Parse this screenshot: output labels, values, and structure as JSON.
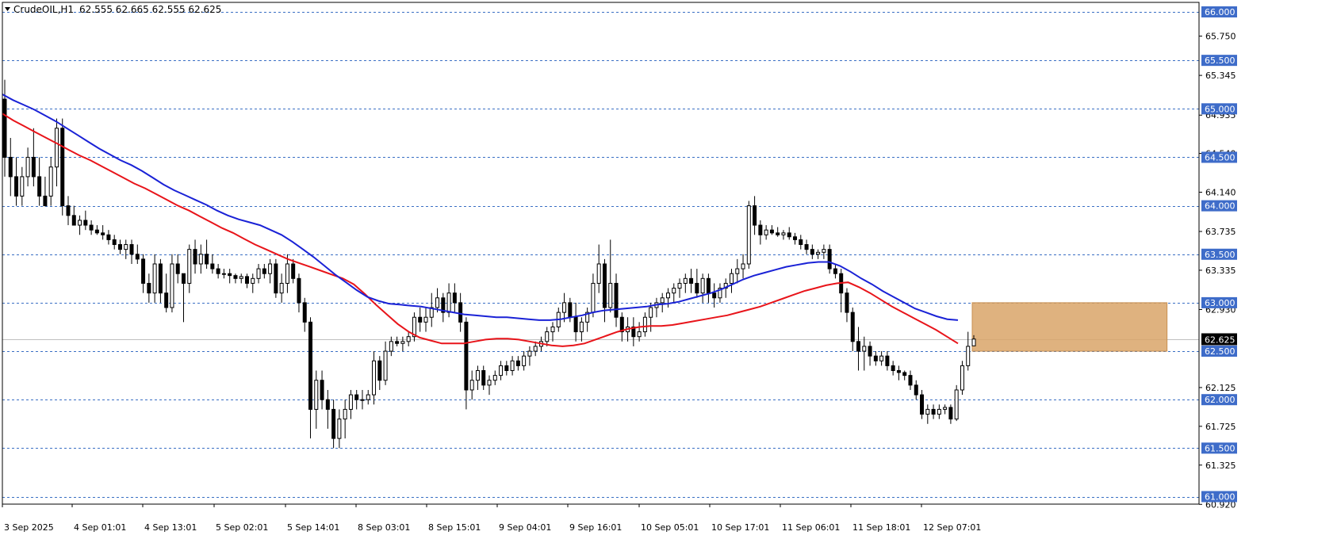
{
  "header": {
    "symbol": "CrudeOIL,H1",
    "ohlc": "62.555 62.665 62.555 62.625"
  },
  "colors": {
    "background": "#ffffff",
    "grid": "#3a6fc4",
    "axis": "#000000",
    "bull_candle": "#ffffff",
    "bear_candle": "#000000",
    "ma_fast": "#e8141a",
    "ma_slow": "#1a22d6",
    "zone": "#d9a468",
    "price_badge": "#000000",
    "level_badge": "#3e6cc9"
  },
  "chart_data": {
    "type": "candlestick",
    "ylim": [
      60.82,
      66.1
    ],
    "y_tick_labels": [
      "65.750",
      "65.345",
      "64.935",
      "64.540",
      "64.140",
      "63.735",
      "63.335",
      "62.930",
      "62.125",
      "61.725",
      "61.325",
      "60.920"
    ],
    "level_labels": [
      "66.000",
      "65.500",
      "65.000",
      "64.500",
      "64.000",
      "63.500",
      "63.000",
      "62.500",
      "62.000",
      "61.500",
      "61.000"
    ],
    "levels": [
      66.0,
      65.5,
      65.0,
      64.5,
      64.0,
      63.5,
      63.0,
      62.5,
      62.0,
      61.5,
      61.0
    ],
    "current_price": 62.625,
    "current_price_label": "62.625",
    "x_tick_labels": [
      "3 Sep 2025",
      "4 Sep 01:01",
      "4 Sep 13:01",
      "5 Sep 02:01",
      "5 Sep 14:01",
      "8 Sep 03:01",
      "8 Sep 15:01",
      "9 Sep 04:01",
      "9 Sep 16:01",
      "10 Sep 05:01",
      "10 Sep 17:01",
      "11 Sep 06:01",
      "11 Sep 18:01",
      "12 Sep 07:01"
    ],
    "candles": [
      [
        65.1,
        65.3,
        64.3,
        64.5
      ],
      [
        64.5,
        64.7,
        64.1,
        64.3
      ],
      [
        64.3,
        64.5,
        64.0,
        64.1
      ],
      [
        64.1,
        64.4,
        64.0,
        64.3
      ],
      [
        64.3,
        64.6,
        64.2,
        64.5
      ],
      [
        64.5,
        64.8,
        64.2,
        64.3
      ],
      [
        64.3,
        64.5,
        64.0,
        64.1
      ],
      [
        64.1,
        64.3,
        64.0,
        64.0
      ],
      [
        64.1,
        64.5,
        64.0,
        64.4
      ],
      [
        64.4,
        64.9,
        64.2,
        64.8
      ],
      [
        64.8,
        64.9,
        63.9,
        64.0
      ],
      [
        64.0,
        64.1,
        63.8,
        63.9
      ],
      [
        63.9,
        64.0,
        63.8,
        63.8
      ],
      [
        63.8,
        63.9,
        63.7,
        63.85
      ],
      [
        63.85,
        63.95,
        63.75,
        63.8
      ],
      [
        63.8,
        63.85,
        63.7,
        63.75
      ],
      [
        63.75,
        63.8,
        63.7,
        63.72
      ],
      [
        63.72,
        63.8,
        63.65,
        63.7
      ],
      [
        63.7,
        63.75,
        63.6,
        63.65
      ],
      [
        63.65,
        63.7,
        63.55,
        63.6
      ],
      [
        63.6,
        63.65,
        63.5,
        63.55
      ],
      [
        63.55,
        63.65,
        63.45,
        63.6
      ],
      [
        63.6,
        63.65,
        63.4,
        63.5
      ],
      [
        63.5,
        63.6,
        63.4,
        63.45
      ],
      [
        63.45,
        63.5,
        63.1,
        63.2
      ],
      [
        63.2,
        63.3,
        63.0,
        63.1
      ],
      [
        63.1,
        63.5,
        63.0,
        63.4
      ],
      [
        63.4,
        63.45,
        63.0,
        63.1
      ],
      [
        63.1,
        63.3,
        62.9,
        62.95
      ],
      [
        62.95,
        63.5,
        62.9,
        63.4
      ],
      [
        63.4,
        63.5,
        63.2,
        63.3
      ],
      [
        63.3,
        63.3,
        62.8,
        63.2
      ],
      [
        63.2,
        63.6,
        63.1,
        63.55
      ],
      [
        63.55,
        63.65,
        63.3,
        63.4
      ],
      [
        63.4,
        63.6,
        63.3,
        63.5
      ],
      [
        63.5,
        63.65,
        63.35,
        63.4
      ],
      [
        63.4,
        63.5,
        63.3,
        63.35
      ],
      [
        63.35,
        63.4,
        63.25,
        63.3
      ],
      [
        63.3,
        63.35,
        63.25,
        63.3
      ],
      [
        63.3,
        63.35,
        63.2,
        63.28
      ],
      [
        63.28,
        63.3,
        63.2,
        63.25
      ],
      [
        63.25,
        63.3,
        63.2,
        63.27
      ],
      [
        63.27,
        63.3,
        63.15,
        63.2
      ],
      [
        63.2,
        63.3,
        63.1,
        63.25
      ],
      [
        63.25,
        63.4,
        63.2,
        63.35
      ],
      [
        63.35,
        63.4,
        63.25,
        63.3
      ],
      [
        63.3,
        63.45,
        63.2,
        63.4
      ],
      [
        63.4,
        63.45,
        63.05,
        63.1
      ],
      [
        63.1,
        63.3,
        63.0,
        63.2
      ],
      [
        63.2,
        63.5,
        63.1,
        63.4
      ],
      [
        63.4,
        63.45,
        63.2,
        63.25
      ],
      [
        63.25,
        63.3,
        62.9,
        63.0
      ],
      [
        63.0,
        63.05,
        62.7,
        62.8
      ],
      [
        62.8,
        62.85,
        61.6,
        61.9
      ],
      [
        61.9,
        62.3,
        61.7,
        62.2
      ],
      [
        62.2,
        62.3,
        61.9,
        62.0
      ],
      [
        62.0,
        62.1,
        61.7,
        61.9
      ],
      [
        61.9,
        62.0,
        61.5,
        61.6
      ],
      [
        61.6,
        61.9,
        61.5,
        61.8
      ],
      [
        61.8,
        62.0,
        61.6,
        61.9
      ],
      [
        61.9,
        62.1,
        61.8,
        62.05
      ],
      [
        62.05,
        62.1,
        61.9,
        62.0
      ],
      [
        62.0,
        62.1,
        61.9,
        62.0
      ],
      [
        62.0,
        62.1,
        61.95,
        62.05
      ],
      [
        62.05,
        62.5,
        61.95,
        62.4
      ],
      [
        62.4,
        62.45,
        62.1,
        62.2
      ],
      [
        62.2,
        62.6,
        62.15,
        62.5
      ],
      [
        62.5,
        62.65,
        62.45,
        62.6
      ],
      [
        62.6,
        62.65,
        62.55,
        62.58
      ],
      [
        62.58,
        62.65,
        62.5,
        62.6
      ],
      [
        62.6,
        62.7,
        62.55,
        62.65
      ],
      [
        62.65,
        62.9,
        62.6,
        62.85
      ],
      [
        62.85,
        62.95,
        62.7,
        62.8
      ],
      [
        62.8,
        62.95,
        62.7,
        62.85
      ],
      [
        62.85,
        63.1,
        62.75,
        62.95
      ],
      [
        62.95,
        63.15,
        62.9,
        63.05
      ],
      [
        63.05,
        63.1,
        62.8,
        62.9
      ],
      [
        62.9,
        63.2,
        62.85,
        63.1
      ],
      [
        63.1,
        63.2,
        62.9,
        63.0
      ],
      [
        63.0,
        63.1,
        62.7,
        62.8
      ],
      [
        62.8,
        62.85,
        61.9,
        62.1
      ],
      [
        62.1,
        62.3,
        62.0,
        62.2
      ],
      [
        62.2,
        62.35,
        62.1,
        62.3
      ],
      [
        62.3,
        62.35,
        62.1,
        62.15
      ],
      [
        62.15,
        62.25,
        62.05,
        62.2
      ],
      [
        62.2,
        62.3,
        62.15,
        62.25
      ],
      [
        62.25,
        62.4,
        62.2,
        62.35
      ],
      [
        62.35,
        62.4,
        62.25,
        62.3
      ],
      [
        62.3,
        62.45,
        62.25,
        62.4
      ],
      [
        62.4,
        62.45,
        62.3,
        62.35
      ],
      [
        62.35,
        62.5,
        62.3,
        62.45
      ],
      [
        62.45,
        62.55,
        62.35,
        62.5
      ],
      [
        62.5,
        62.6,
        62.45,
        62.55
      ],
      [
        62.55,
        62.65,
        62.5,
        62.6
      ],
      [
        62.6,
        62.75,
        62.55,
        62.7
      ],
      [
        62.7,
        62.8,
        62.6,
        62.75
      ],
      [
        62.75,
        62.95,
        62.7,
        62.9
      ],
      [
        62.9,
        63.1,
        62.8,
        63.0
      ],
      [
        63.0,
        63.05,
        62.8,
        62.85
      ],
      [
        62.85,
        63.0,
        62.6,
        62.7
      ],
      [
        62.7,
        62.85,
        62.6,
        62.8
      ],
      [
        62.8,
        62.95,
        62.7,
        62.9
      ],
      [
        62.9,
        63.3,
        62.85,
        63.2
      ],
      [
        63.2,
        63.6,
        63.1,
        63.4
      ],
      [
        63.4,
        63.45,
        62.8,
        62.95
      ],
      [
        62.95,
        63.65,
        62.9,
        63.2
      ],
      [
        63.2,
        63.3,
        62.75,
        62.85
      ],
      [
        62.85,
        62.9,
        62.6,
        62.7
      ],
      [
        62.7,
        62.85,
        62.6,
        62.75
      ],
      [
        62.75,
        62.85,
        62.55,
        62.65
      ],
      [
        62.65,
        62.8,
        62.6,
        62.7
      ],
      [
        62.7,
        62.9,
        62.65,
        62.85
      ],
      [
        62.85,
        63.0,
        62.7,
        62.95
      ],
      [
        62.95,
        63.05,
        62.85,
        63.0
      ],
      [
        63.0,
        63.1,
        62.9,
        63.05
      ],
      [
        63.05,
        63.15,
        62.95,
        63.1
      ],
      [
        63.1,
        63.2,
        63.0,
        63.15
      ],
      [
        63.15,
        63.25,
        63.05,
        63.2
      ],
      [
        63.2,
        63.3,
        63.1,
        63.25
      ],
      [
        63.25,
        63.35,
        63.1,
        63.2
      ],
      [
        63.2,
        63.35,
        63.05,
        63.1
      ],
      [
        63.1,
        63.3,
        63.0,
        63.25
      ],
      [
        63.25,
        63.3,
        63.0,
        63.1
      ],
      [
        63.1,
        63.2,
        62.95,
        63.05
      ],
      [
        63.05,
        63.2,
        63.0,
        63.15
      ],
      [
        63.15,
        63.25,
        63.05,
        63.2
      ],
      [
        63.2,
        63.35,
        63.1,
        63.3
      ],
      [
        63.3,
        63.45,
        63.2,
        63.35
      ],
      [
        63.35,
        63.5,
        63.25,
        63.4
      ],
      [
        63.4,
        64.05,
        63.35,
        64.0
      ],
      [
        64.0,
        64.1,
        63.7,
        63.8
      ],
      [
        63.8,
        63.85,
        63.6,
        63.7
      ],
      [
        63.7,
        63.8,
        63.65,
        63.75
      ],
      [
        63.75,
        63.8,
        63.7,
        63.72
      ],
      [
        63.72,
        63.78,
        63.68,
        63.7
      ],
      [
        63.7,
        63.75,
        63.65,
        63.72
      ],
      [
        63.72,
        63.78,
        63.65,
        63.68
      ],
      [
        63.68,
        63.72,
        63.6,
        63.65
      ],
      [
        63.65,
        63.7,
        63.55,
        63.6
      ],
      [
        63.6,
        63.65,
        63.5,
        63.55
      ],
      [
        63.55,
        63.6,
        63.45,
        63.5
      ],
      [
        63.5,
        63.55,
        63.45,
        63.52
      ],
      [
        63.52,
        63.6,
        63.45,
        63.55
      ],
      [
        63.55,
        63.6,
        63.3,
        63.35
      ],
      [
        63.35,
        63.4,
        63.25,
        63.3
      ],
      [
        63.3,
        63.35,
        62.9,
        63.1
      ],
      [
        63.1,
        63.15,
        62.8,
        62.9
      ],
      [
        62.9,
        62.95,
        62.5,
        62.6
      ],
      [
        62.6,
        62.75,
        62.3,
        62.5
      ],
      [
        62.5,
        62.65,
        62.3,
        62.55
      ],
      [
        62.55,
        62.6,
        62.35,
        62.45
      ],
      [
        62.45,
        62.5,
        62.35,
        62.4
      ],
      [
        62.4,
        62.5,
        62.35,
        62.45
      ],
      [
        62.45,
        62.5,
        62.3,
        62.35
      ],
      [
        62.35,
        62.4,
        62.25,
        62.3
      ],
      [
        62.3,
        62.35,
        62.2,
        62.28
      ],
      [
        62.28,
        62.3,
        62.2,
        62.25
      ],
      [
        62.25,
        62.3,
        62.1,
        62.15
      ],
      [
        62.15,
        62.2,
        62.0,
        62.05
      ],
      [
        62.05,
        62.1,
        61.8,
        61.85
      ],
      [
        61.85,
        61.95,
        61.75,
        61.9
      ],
      [
        61.9,
        61.95,
        61.8,
        61.85
      ],
      [
        61.85,
        61.95,
        61.8,
        61.9
      ],
      [
        61.9,
        61.95,
        61.85,
        61.92
      ],
      [
        61.92,
        61.95,
        61.75,
        61.8
      ],
      [
        61.8,
        62.15,
        61.78,
        62.1
      ],
      [
        62.1,
        62.4,
        62.05,
        62.35
      ],
      [
        62.35,
        62.7,
        62.3,
        62.55
      ],
      [
        62.555,
        62.665,
        62.555,
        62.625
      ]
    ],
    "zone": {
      "y_top": 63.0,
      "y_bottom": 62.5,
      "x_start_index": 168,
      "x_end_index": 196
    },
    "series": [
      {
        "type": "line",
        "values": [
          64.95,
          64.88,
          64.82,
          64.76,
          64.7,
          64.64,
          64.58,
          64.52,
          64.47,
          64.41,
          64.35,
          64.29,
          64.23,
          64.18,
          64.12,
          64.06,
          64.0,
          63.95,
          63.89,
          63.83,
          63.77,
          63.72,
          63.66,
          63.6,
          63.55,
          63.5,
          63.45,
          63.41,
          63.37,
          63.33,
          63.29,
          63.25,
          63.19,
          63.09,
          62.98,
          62.88,
          62.78,
          62.7,
          62.64,
          62.61,
          62.58,
          62.58,
          62.58,
          62.6,
          62.62,
          62.63,
          62.63,
          62.62,
          62.6,
          62.58,
          62.56,
          62.55,
          62.56,
          62.58,
          62.62,
          62.66,
          62.7,
          62.73,
          62.75,
          62.76,
          62.76,
          62.77,
          62.79,
          62.81,
          62.83,
          62.85,
          62.87,
          62.9,
          62.93,
          62.96,
          63.0,
          63.04,
          63.08,
          63.12,
          63.15,
          63.18,
          63.2,
          63.21,
          63.16,
          63.1,
          63.03,
          62.96,
          62.9,
          62.84,
          62.78,
          62.72,
          62.65,
          62.58
        ]
      },
      {
        "type": "line",
        "values": [
          65.15,
          65.09,
          65.04,
          64.99,
          64.93,
          64.87,
          64.8,
          64.73,
          64.66,
          64.59,
          64.53,
          64.47,
          64.42,
          64.36,
          64.29,
          64.22,
          64.16,
          64.11,
          64.06,
          64.01,
          63.95,
          63.9,
          63.86,
          63.83,
          63.8,
          63.75,
          63.7,
          63.63,
          63.55,
          63.47,
          63.38,
          63.29,
          63.21,
          63.13,
          63.06,
          63.02,
          62.99,
          62.98,
          62.97,
          62.96,
          62.94,
          62.92,
          62.9,
          62.88,
          62.87,
          62.86,
          62.85,
          62.85,
          62.84,
          62.83,
          62.82,
          62.82,
          62.83,
          62.85,
          62.87,
          62.9,
          62.92,
          62.93,
          62.94,
          62.95,
          62.96,
          62.98,
          62.99,
          63.01,
          63.04,
          63.07,
          63.1,
          63.14,
          63.19,
          63.24,
          63.28,
          63.31,
          63.34,
          63.37,
          63.39,
          63.41,
          63.42,
          63.42,
          63.38,
          63.32,
          63.25,
          63.19,
          63.12,
          63.06,
          63.0,
          62.94,
          62.9,
          62.86,
          62.83,
          62.82
        ]
      }
    ]
  }
}
